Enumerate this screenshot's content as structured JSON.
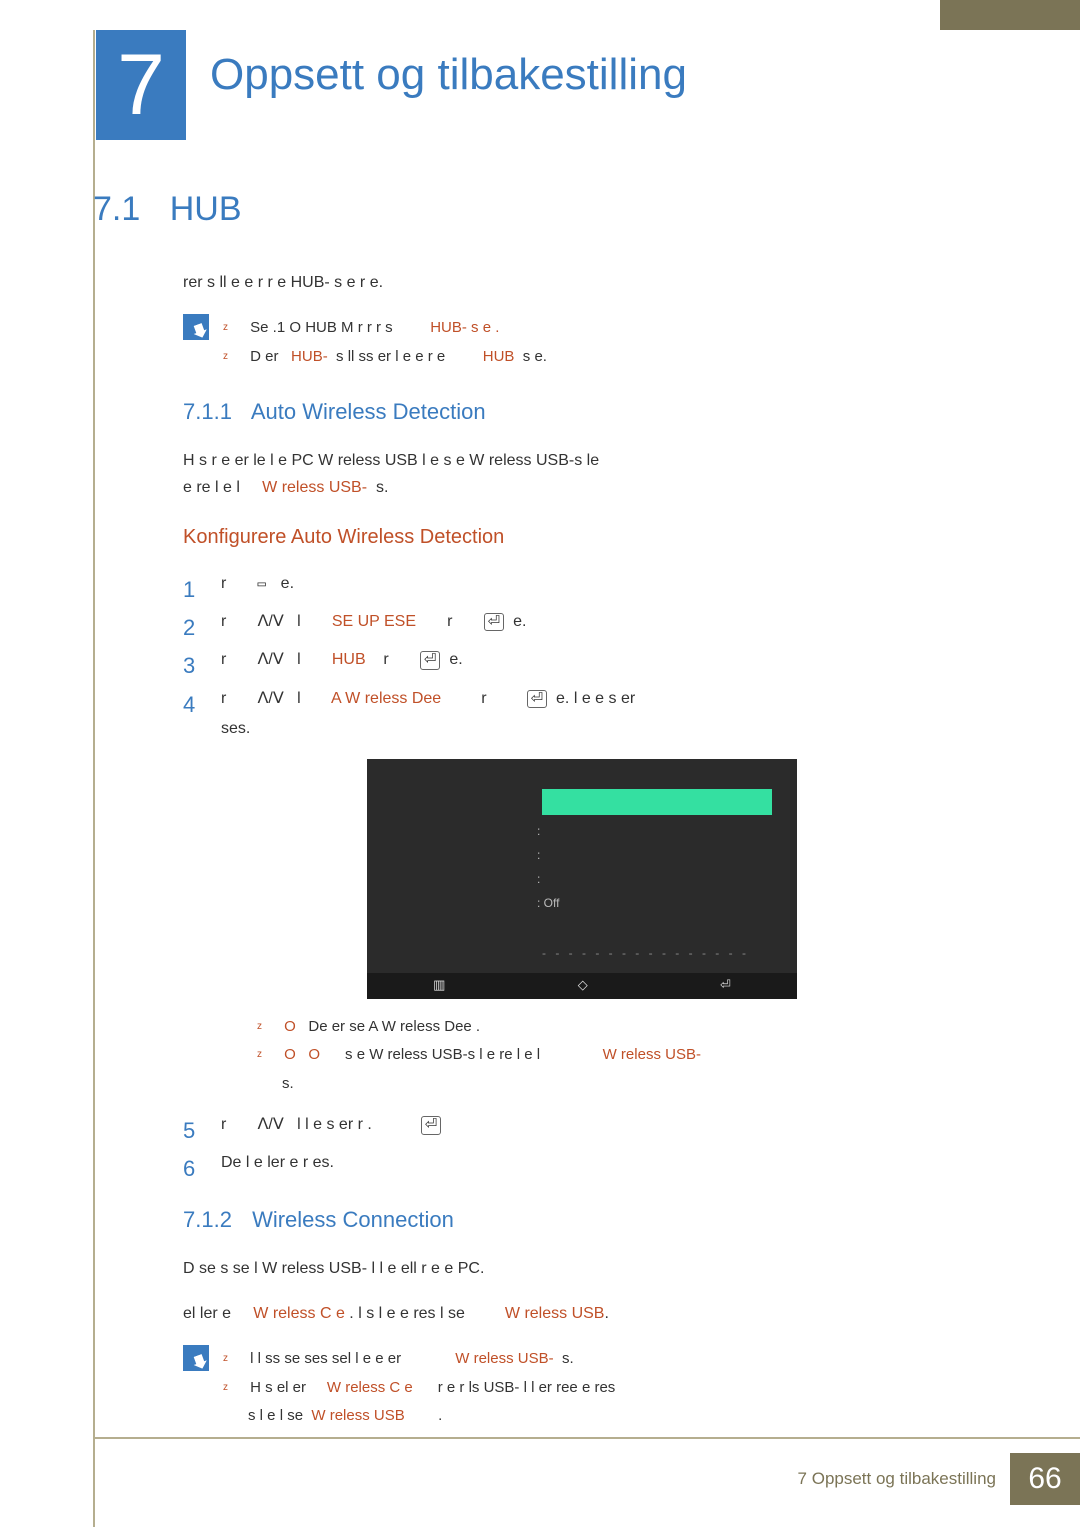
{
  "chapter": {
    "number": "7",
    "title": "Oppsett og tilbakestilling"
  },
  "section": {
    "number": "7.1",
    "title": "HUB",
    "intro": "rer   s ll   e e   r   r e HUB-   s   e      r   e.",
    "note1_a": "Se    .1 O   HUB M   r   r   r   s",
    "note1_a_accent": "HUB-   s   e .",
    "note1_b_pre": "D   er",
    "note1_b_accent1": "HUB-",
    "note1_b_mid": "s ll   ss er   l e e   r   e",
    "note1_b_accent2": "HUB",
    "note1_b_post": "s   e."
  },
  "sub1": {
    "number": "7.1.1",
    "title": "Auto Wireless Detection",
    "para1_a": "H s   r   e er   le   l e   PC             W reless USB   l   e      s             e W reless USB-s     le",
    "para1_b_pre": "e   re        l   e   l",
    "para1_b_accent": "W reless USB-",
    "para1_b_post": "s.",
    "h3": "Konfigurere Auto Wireless Detection",
    "steps": {
      "s1_a": "r",
      "s1_b": "e.",
      "s2_a": "r",
      "s2_b": "l",
      "s2_accent": "SE UP  ESE",
      "s2_c": "r",
      "s2_d": "e.",
      "s3_a": "r",
      "s3_b": "l",
      "s3_accent": "HUB",
      "s3_c": "r",
      "s3_d": "e.",
      "s4_a": "r",
      "s4_b": "l",
      "s4_accent": "A   W reless Dee",
      "s4_c": "r",
      "s4_d": "e.   l   e   e s   er",
      "s4_cont": "ses.",
      "s5_a": "r",
      "s5_b": "l   l   e    s   er   r        .",
      "s6": "De   l   e   ler   e   r es."
    },
    "sub_bullets": {
      "b1_pre": "O",
      "b1_mid": "De   er   se   A          W reless Dee    .",
      "b2_pre": "O",
      "b2_pre2": "O",
      "b2_mid": "s   e W reless USB-s    l    e   re       l   e   l",
      "b2_accent": "W reless USB-",
      "b2_post": "s."
    },
    "osd": {
      "rows": [
        "",
        "",
        "",
        "Off"
      ],
      "dots": "- - - - - - - - - - - - - - - -"
    }
  },
  "sub2": {
    "number": "7.1.2",
    "title": "Wireless Connection",
    "para1": "D       se s se   l W reless USB- l   l   e   ell   r   e   e   PC.",
    "para2_pre": "el   ler   e",
    "para2_accent1": "W reless C   e",
    "para2_mid": ". l     s   l e   e   res l   se",
    "para2_accent2": "W reless USB",
    "note": {
      "r1_a": "l    l    ss se   ses sel          l   e    e er",
      "r1_accent": "W reless USB-",
      "r1_b": "s.",
      "r2_a": "H s   el er",
      "r2_accent1": "W reless C   e",
      "r2_b": "r   e   r ls USB- l   l   er    ree   e   res",
      "r3_a": "s   l   e     l    se",
      "r3_accent": "W reless USB",
      "r3_b": "."
    }
  },
  "footer": {
    "text": "7 Oppsett og tilbakestilling",
    "page": "66"
  }
}
